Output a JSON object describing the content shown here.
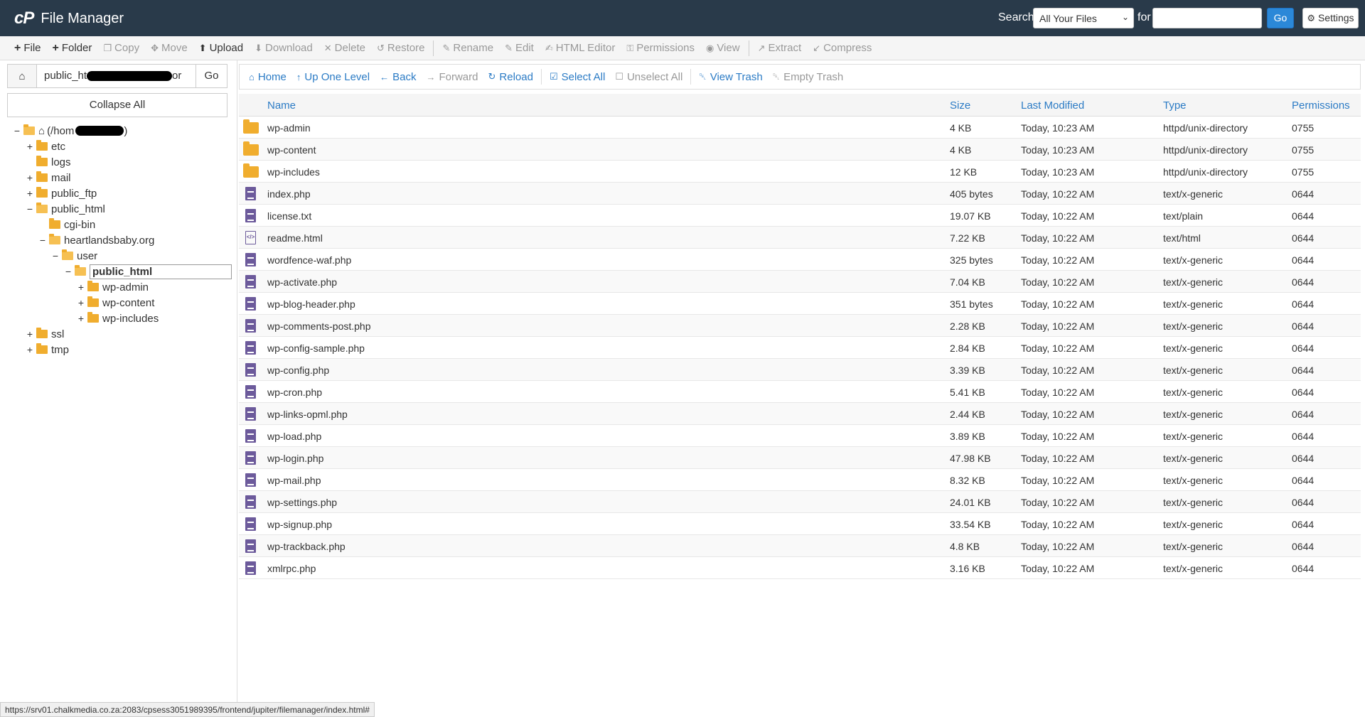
{
  "header": {
    "logo": "cP",
    "title": "File Manager",
    "search_label": "Search",
    "search_scope": "All Your Files",
    "for_label": "for",
    "search_value": "",
    "go_label": "Go",
    "settings_label": "Settings"
  },
  "toolbar": [
    {
      "label": "File",
      "icon": "plus-icon",
      "enabled": true
    },
    {
      "label": "Folder",
      "icon": "plus-icon",
      "enabled": true
    },
    {
      "label": "Copy",
      "icon": "copy-icon",
      "enabled": false
    },
    {
      "label": "Move",
      "icon": "move-icon",
      "enabled": false
    },
    {
      "label": "Upload",
      "icon": "upload-icon",
      "enabled": true
    },
    {
      "label": "Download",
      "icon": "download-icon",
      "enabled": false
    },
    {
      "label": "Delete",
      "icon": "delete-icon",
      "enabled": false
    },
    {
      "label": "Restore",
      "icon": "restore-icon",
      "enabled": false
    },
    {
      "label": "Rename",
      "icon": "rename-icon",
      "enabled": false
    },
    {
      "label": "Edit",
      "icon": "edit-icon",
      "enabled": false
    },
    {
      "label": "HTML Editor",
      "icon": "html-editor-icon",
      "enabled": false
    },
    {
      "label": "Permissions",
      "icon": "key-icon",
      "enabled": false
    },
    {
      "label": "View",
      "icon": "eye-icon",
      "enabled": false
    },
    {
      "label": "Extract",
      "icon": "extract-icon",
      "enabled": false
    },
    {
      "label": "Compress",
      "icon": "compress-icon",
      "enabled": false
    }
  ],
  "sidebar": {
    "path_value": "public_ht",
    "path_suffix": "or",
    "go_label": "Go",
    "collapse_label": "Collapse All",
    "tree": [
      {
        "label": "(/hom",
        "toggle": "−",
        "indent": 0,
        "open": true,
        "home": true
      },
      {
        "label": "etc",
        "toggle": "+",
        "indent": 1,
        "open": false
      },
      {
        "label": "logs",
        "toggle": "",
        "indent": 1,
        "open": false
      },
      {
        "label": "mail",
        "toggle": "+",
        "indent": 1,
        "open": false
      },
      {
        "label": "public_ftp",
        "toggle": "+",
        "indent": 1,
        "open": false
      },
      {
        "label": "public_html",
        "toggle": "−",
        "indent": 1,
        "open": true
      },
      {
        "label": "cgi-bin",
        "toggle": "",
        "indent": 2,
        "open": false
      },
      {
        "label": "heartlandsbaby.org",
        "toggle": "−",
        "indent": 2,
        "open": true
      },
      {
        "label": "user",
        "toggle": "−",
        "indent": 3,
        "open": true
      },
      {
        "label": "public_html",
        "toggle": "−",
        "indent": 4,
        "open": true,
        "selected": true
      },
      {
        "label": "wp-admin",
        "toggle": "+",
        "indent": 5,
        "open": false
      },
      {
        "label": "wp-content",
        "toggle": "+",
        "indent": 5,
        "open": false
      },
      {
        "label": "wp-includes",
        "toggle": "+",
        "indent": 5,
        "open": false
      },
      {
        "label": "ssl",
        "toggle": "+",
        "indent": 1,
        "open": false
      },
      {
        "label": "tmp",
        "toggle": "+",
        "indent": 1,
        "open": false
      }
    ]
  },
  "nav": [
    {
      "label": "Home",
      "icon": "home-icon",
      "enabled": true
    },
    {
      "label": "Up One Level",
      "icon": "up-level-icon",
      "enabled": true
    },
    {
      "label": "Back",
      "icon": "arrow-left-icon",
      "enabled": true
    },
    {
      "label": "Forward",
      "icon": "arrow-right-icon",
      "enabled": false
    },
    {
      "label": "Reload",
      "icon": "reload-icon",
      "enabled": true
    },
    {
      "label": "Select All",
      "icon": "check-square-icon",
      "enabled": true
    },
    {
      "label": "Unselect All",
      "icon": "square-icon",
      "enabled": false
    },
    {
      "label": "View Trash",
      "icon": "trash-icon",
      "enabled": true
    },
    {
      "label": "Empty Trash",
      "icon": "trash-icon",
      "enabled": false
    }
  ],
  "table": {
    "columns": {
      "name": "Name",
      "size": "Size",
      "modified": "Last Modified",
      "type": "Type",
      "permissions": "Permissions"
    },
    "rows": [
      {
        "name": "wp-admin",
        "size": "4 KB",
        "modified": "Today, 10:23 AM",
        "type": "httpd/unix-directory",
        "perm": "0755",
        "kind": "dir"
      },
      {
        "name": "wp-content",
        "size": "4 KB",
        "modified": "Today, 10:23 AM",
        "type": "httpd/unix-directory",
        "perm": "0755",
        "kind": "dir"
      },
      {
        "name": "wp-includes",
        "size": "12 KB",
        "modified": "Today, 10:23 AM",
        "type": "httpd/unix-directory",
        "perm": "0755",
        "kind": "dir"
      },
      {
        "name": "index.php",
        "size": "405 bytes",
        "modified": "Today, 10:22 AM",
        "type": "text/x-generic",
        "perm": "0644",
        "kind": "file"
      },
      {
        "name": "license.txt",
        "size": "19.07 KB",
        "modified": "Today, 10:22 AM",
        "type": "text/plain",
        "perm": "0644",
        "kind": "file"
      },
      {
        "name": "readme.html",
        "size": "7.22 KB",
        "modified": "Today, 10:22 AM",
        "type": "text/html",
        "perm": "0644",
        "kind": "html"
      },
      {
        "name": "wordfence-waf.php",
        "size": "325 bytes",
        "modified": "Today, 10:22 AM",
        "type": "text/x-generic",
        "perm": "0644",
        "kind": "file"
      },
      {
        "name": "wp-activate.php",
        "size": "7.04 KB",
        "modified": "Today, 10:22 AM",
        "type": "text/x-generic",
        "perm": "0644",
        "kind": "file"
      },
      {
        "name": "wp-blog-header.php",
        "size": "351 bytes",
        "modified": "Today, 10:22 AM",
        "type": "text/x-generic",
        "perm": "0644",
        "kind": "file"
      },
      {
        "name": "wp-comments-post.php",
        "size": "2.28 KB",
        "modified": "Today, 10:22 AM",
        "type": "text/x-generic",
        "perm": "0644",
        "kind": "file"
      },
      {
        "name": "wp-config-sample.php",
        "size": "2.84 KB",
        "modified": "Today, 10:22 AM",
        "type": "text/x-generic",
        "perm": "0644",
        "kind": "file"
      },
      {
        "name": "wp-config.php",
        "size": "3.39 KB",
        "modified": "Today, 10:22 AM",
        "type": "text/x-generic",
        "perm": "0644",
        "kind": "file"
      },
      {
        "name": "wp-cron.php",
        "size": "5.41 KB",
        "modified": "Today, 10:22 AM",
        "type": "text/x-generic",
        "perm": "0644",
        "kind": "file"
      },
      {
        "name": "wp-links-opml.php",
        "size": "2.44 KB",
        "modified": "Today, 10:22 AM",
        "type": "text/x-generic",
        "perm": "0644",
        "kind": "file"
      },
      {
        "name": "wp-load.php",
        "size": "3.89 KB",
        "modified": "Today, 10:22 AM",
        "type": "text/x-generic",
        "perm": "0644",
        "kind": "file"
      },
      {
        "name": "wp-login.php",
        "size": "47.98 KB",
        "modified": "Today, 10:22 AM",
        "type": "text/x-generic",
        "perm": "0644",
        "kind": "file"
      },
      {
        "name": "wp-mail.php",
        "size": "8.32 KB",
        "modified": "Today, 10:22 AM",
        "type": "text/x-generic",
        "perm": "0644",
        "kind": "file"
      },
      {
        "name": "wp-settings.php",
        "size": "24.01 KB",
        "modified": "Today, 10:22 AM",
        "type": "text/x-generic",
        "perm": "0644",
        "kind": "file"
      },
      {
        "name": "wp-signup.php",
        "size": "33.54 KB",
        "modified": "Today, 10:22 AM",
        "type": "text/x-generic",
        "perm": "0644",
        "kind": "file"
      },
      {
        "name": "wp-trackback.php",
        "size": "4.8 KB",
        "modified": "Today, 10:22 AM",
        "type": "text/x-generic",
        "perm": "0644",
        "kind": "file"
      },
      {
        "name": "xmlrpc.php",
        "size": "3.16 KB",
        "modified": "Today, 10:22 AM",
        "type": "text/x-generic",
        "perm": "0644",
        "kind": "file"
      }
    ]
  },
  "status_url": "https://srv01.chalkmedia.co.za:2083/cpsess3051989395/frontend/jupiter/filemanager/index.html#",
  "colors": {
    "header_bg": "#293a4a",
    "accent": "#2b7bc5",
    "folder": "#f0ad2e",
    "file": "#6c5a9b"
  }
}
